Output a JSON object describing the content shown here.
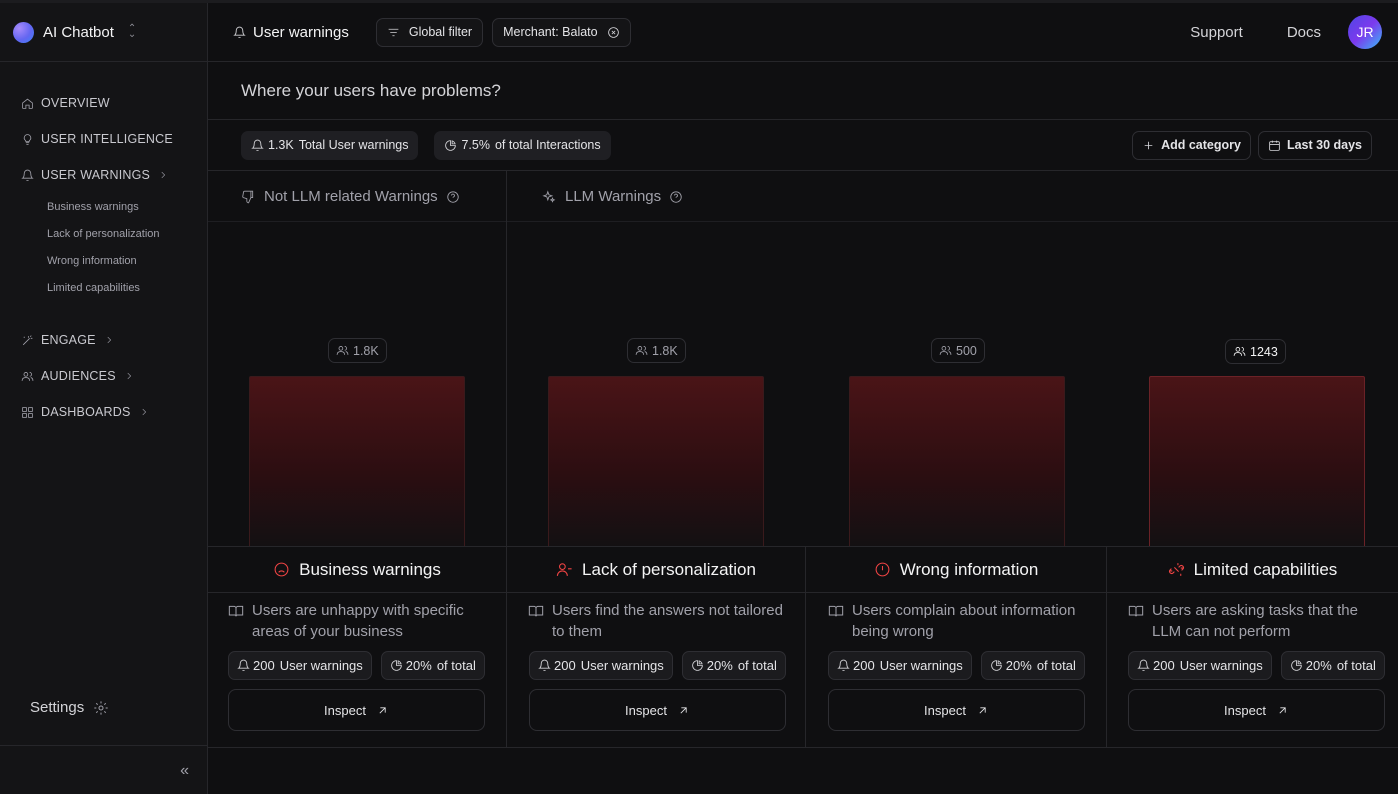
{
  "app": {
    "name": "AI Chatbot"
  },
  "sidebar": {
    "items": [
      {
        "label": "OVERVIEW",
        "icon": "home-icon"
      },
      {
        "label": "USER INTELLIGENCE",
        "icon": "lightbulb-icon"
      },
      {
        "label": "USER WARNINGS",
        "icon": "bell-icon",
        "expanded": true
      },
      {
        "label": "ENGAGE",
        "icon": "wand-icon"
      },
      {
        "label": "AUDIENCES",
        "icon": "users-icon"
      },
      {
        "label": "DASHBOARDS",
        "icon": "grid-icon"
      }
    ],
    "subitems": [
      "Business warnings",
      "Lack of personalization",
      "Wrong information",
      "Limited capabilities"
    ],
    "settings_label": "Settings",
    "collapse_glyph": "«"
  },
  "header": {
    "title": "User warnings",
    "global_filter": "Global filter",
    "merchant_filter": "Merchant: Balato",
    "support": "Support",
    "docs": "Docs",
    "avatar_initials": "JR"
  },
  "question": "Where your users have problems?",
  "stats": {
    "warnings_value": "1.3K",
    "warnings_label": "Total User warnings",
    "interactions_value": "7.5%",
    "interactions_label": "of total Interactions",
    "add_category": "Add category",
    "date_range": "Last 30 days"
  },
  "groups": {
    "not_llm": "Not LLM related Warnings",
    "llm": "LLM Warnings"
  },
  "categories": [
    {
      "title": "Business warnings",
      "icon": "frown-icon",
      "users": "1.8K",
      "description_lines": [
        "Users are unhappy with specific",
        "areas of your business"
      ],
      "warnings_value": "200",
      "warnings_label": "User warnings",
      "share_value": "20%",
      "share_label": "of total",
      "inspect": "Inspect"
    },
    {
      "title": "Lack of personalization",
      "icon": "user-minus-icon",
      "users": "1.8K",
      "description_lines": [
        "Users find the answers not tailored",
        "to them"
      ],
      "warnings_value": "200",
      "warnings_label": "User warnings",
      "share_value": "20%",
      "share_label": "of total",
      "inspect": "Inspect"
    },
    {
      "title": "Wrong information",
      "icon": "alert-circle-icon",
      "users": "500",
      "description_lines": [
        "Users complain about information",
        "being wrong"
      ],
      "warnings_value": "200",
      "warnings_label": "User warnings",
      "share_value": "20%",
      "share_label": "of total",
      "inspect": "Inspect"
    },
    {
      "title": "Limited capabilities",
      "icon": "unlink-icon",
      "users": "1243",
      "description_lines": [
        "Users are asking tasks that the",
        "LLM can not perform"
      ],
      "warnings_value": "200",
      "warnings_label": "User warnings",
      "share_value": "20%",
      "share_label": "of total",
      "inspect": "Inspect",
      "highlighted": true
    }
  ],
  "colors": {
    "accent_red": "#ef4444",
    "bar_top": "#4a1417",
    "background": "#0f0f11"
  }
}
